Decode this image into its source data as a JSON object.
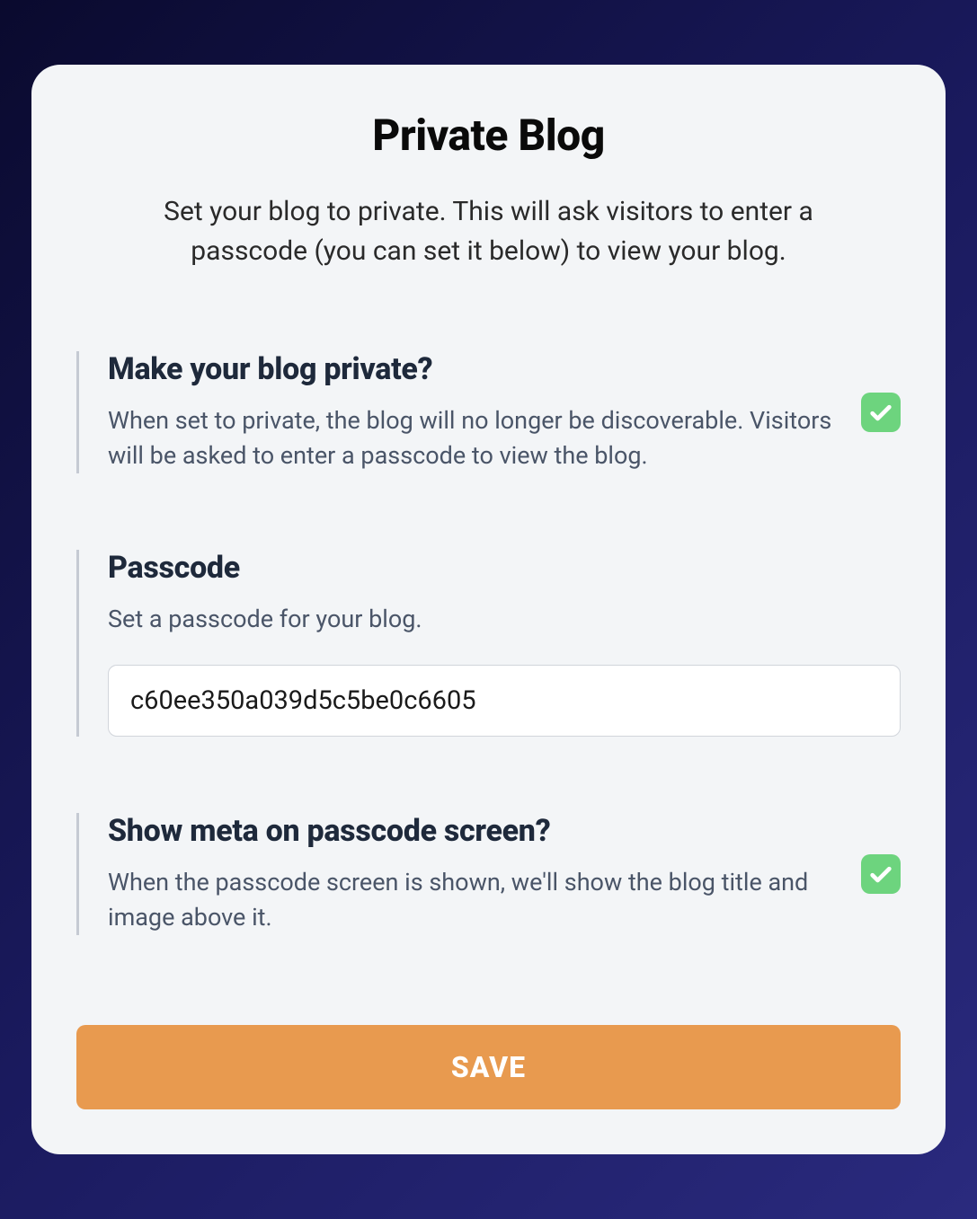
{
  "header": {
    "title": "Private Blog",
    "subtitle": "Set your blog to private. This will ask visitors to enter a passcode (you can set it below) to view your blog."
  },
  "sections": {
    "private": {
      "title": "Make your blog private?",
      "description": "When set to private, the blog will no longer be discoverable. Visitors will be asked to enter a passcode to view the blog.",
      "checked": true
    },
    "passcode": {
      "title": "Passcode",
      "description": "Set a passcode for your blog.",
      "value": "c60ee350a039d5c5be0c6605"
    },
    "meta": {
      "title": "Show meta on passcode screen?",
      "description": "When the passcode screen is shown, we'll show the blog title and image above it.",
      "checked": true
    }
  },
  "actions": {
    "save_label": "SAVE"
  },
  "colors": {
    "accent": "#e89a4f",
    "checkbox": "#6dd47e"
  }
}
